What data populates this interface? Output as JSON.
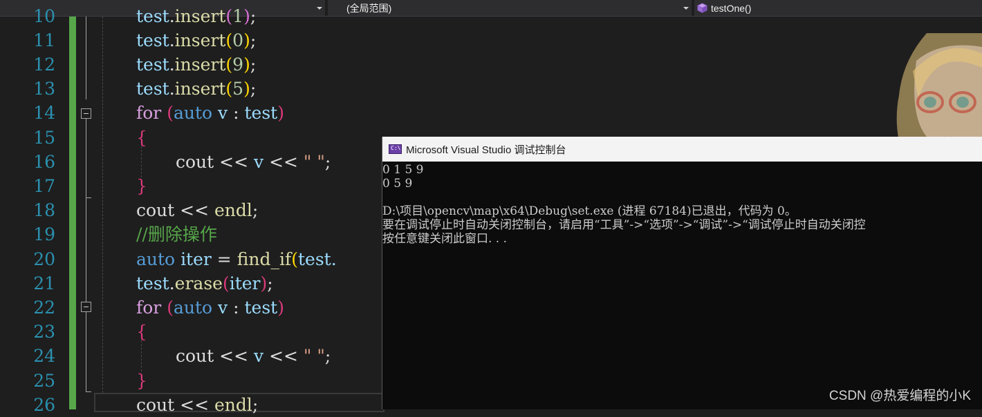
{
  "navbar": {
    "scope_label": "(全局范围)",
    "member_label": "testOne()"
  },
  "editor": {
    "line_numbers": [
      "10",
      "11",
      "12",
      "13",
      "14",
      "15",
      "16",
      "17",
      "18",
      "19",
      "20",
      "21",
      "22",
      "23",
      "24",
      "25",
      "26"
    ],
    "lines": {
      "l10": {
        "obj": "test",
        "dot": ".",
        "fn": "insert",
        "lp": "(",
        "arg": "1",
        "rp": ")",
        "semi": ";"
      },
      "l11": {
        "obj": "test",
        "dot": ".",
        "fn": "insert",
        "lp": "(",
        "arg": "0",
        "rp": ")",
        "semi": ";"
      },
      "l12": {
        "obj": "test",
        "dot": ".",
        "fn": "insert",
        "lp": "(",
        "arg": "9",
        "rp": ")",
        "semi": ";"
      },
      "l13": {
        "obj": "test",
        "dot": ".",
        "fn": "insert",
        "lp": "(",
        "arg": "5",
        "rp": ")",
        "semi": ";"
      },
      "l14": {
        "kw": "for",
        "sp": " ",
        "lp": "(",
        "type": "auto",
        "v": " v ",
        "colon": ":",
        "range": " test",
        "rp": ")"
      },
      "l15": {
        "brace": "{"
      },
      "l16": {
        "a": "cout",
        "b": " << ",
        "c": "v",
        "d": " << ",
        "e": "\" \"",
        "f": ";"
      },
      "l17": {
        "brace": "}"
      },
      "l18": {
        "a": "cout",
        "b": " << ",
        "c": "endl",
        "d": ";"
      },
      "l19": {
        "comment": "//删除操作"
      },
      "l20": {
        "type": "auto",
        "sp": " ",
        "var": "iter",
        "eq": " = ",
        "fn": "find_if",
        "lp": "(",
        "obj": "test."
      },
      "l21": {
        "obj": "test",
        "dot": ".",
        "fn": "erase",
        "lp": "(",
        "arg": "iter",
        "rp": ")",
        "semi": ";"
      },
      "l22": {
        "kw": "for",
        "sp": " ",
        "lp": "(",
        "type": "auto",
        "v": " v ",
        "colon": ":",
        "range": " test",
        "rp": ")"
      },
      "l23": {
        "brace": "{"
      },
      "l24": {
        "a": "cout",
        "b": " << ",
        "c": "v",
        "d": " << ",
        "e": "\" \"",
        "f": ";"
      },
      "l25": {
        "brace": "}"
      },
      "l26": {
        "a": "cout",
        "b": " << ",
        "c": "endl",
        "d": ";"
      }
    }
  },
  "console": {
    "title": "Microsoft Visual Studio 调试控制台",
    "output": [
      "0 1 5 9",
      "0 5 9",
      "",
      "D:\\项目\\opencv\\map\\x64\\Debug\\set.exe (进程 67184)已退出，代码为 0。",
      "要在调试停止时自动关闭控制台，请启用“工具”->“选项”->“调试”->“调试停止时自动关闭控",
      "按任意键关闭此窗口. . ."
    ]
  },
  "watermark": "CSDN @热爱编程的小K",
  "colors": {
    "editor_bg": "#1e1e1e",
    "line_number": "#2b91af",
    "change_bar": "#57a64a",
    "keyword": "#d8a0df",
    "type": "#569cd6",
    "function": "#dcdcaa",
    "comment": "#57a64a",
    "console_bg": "#0c0c0c"
  }
}
